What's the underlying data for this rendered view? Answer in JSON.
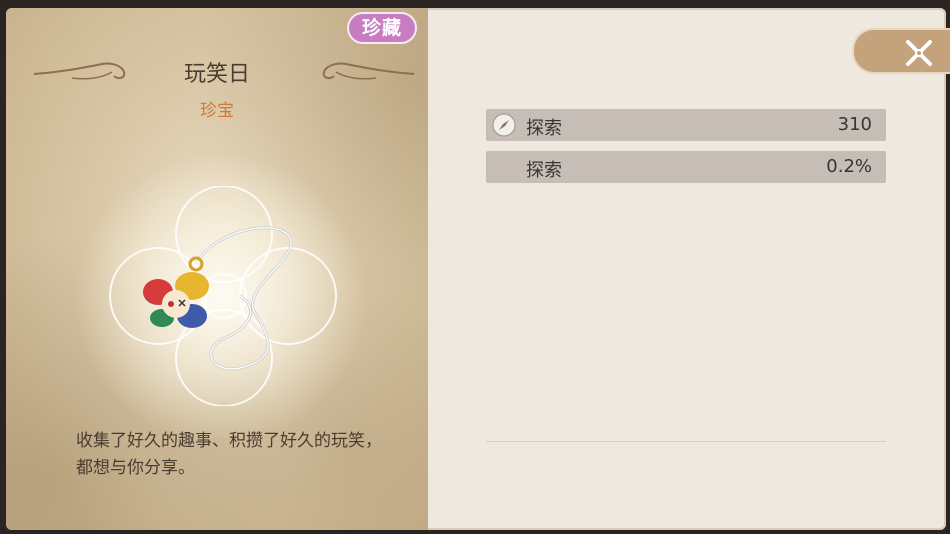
{
  "item": {
    "rarity_tag": "珍藏",
    "name": "玩笑日",
    "category": "珍宝",
    "description": "收集了好久的趣事、积攒了好久的玩笑，都想与你分享。"
  },
  "stats": [
    {
      "icon": "compass-icon",
      "label": "探索",
      "value": "310"
    },
    {
      "icon": "",
      "label": "探索",
      "value": "0.2%"
    }
  ],
  "colors": {
    "rarity_tag_bg": "#c97dc1",
    "category_text": "#d27a33",
    "stat_row_bg": "#c6bdb6",
    "close_button_bg": "#c4a27c"
  }
}
